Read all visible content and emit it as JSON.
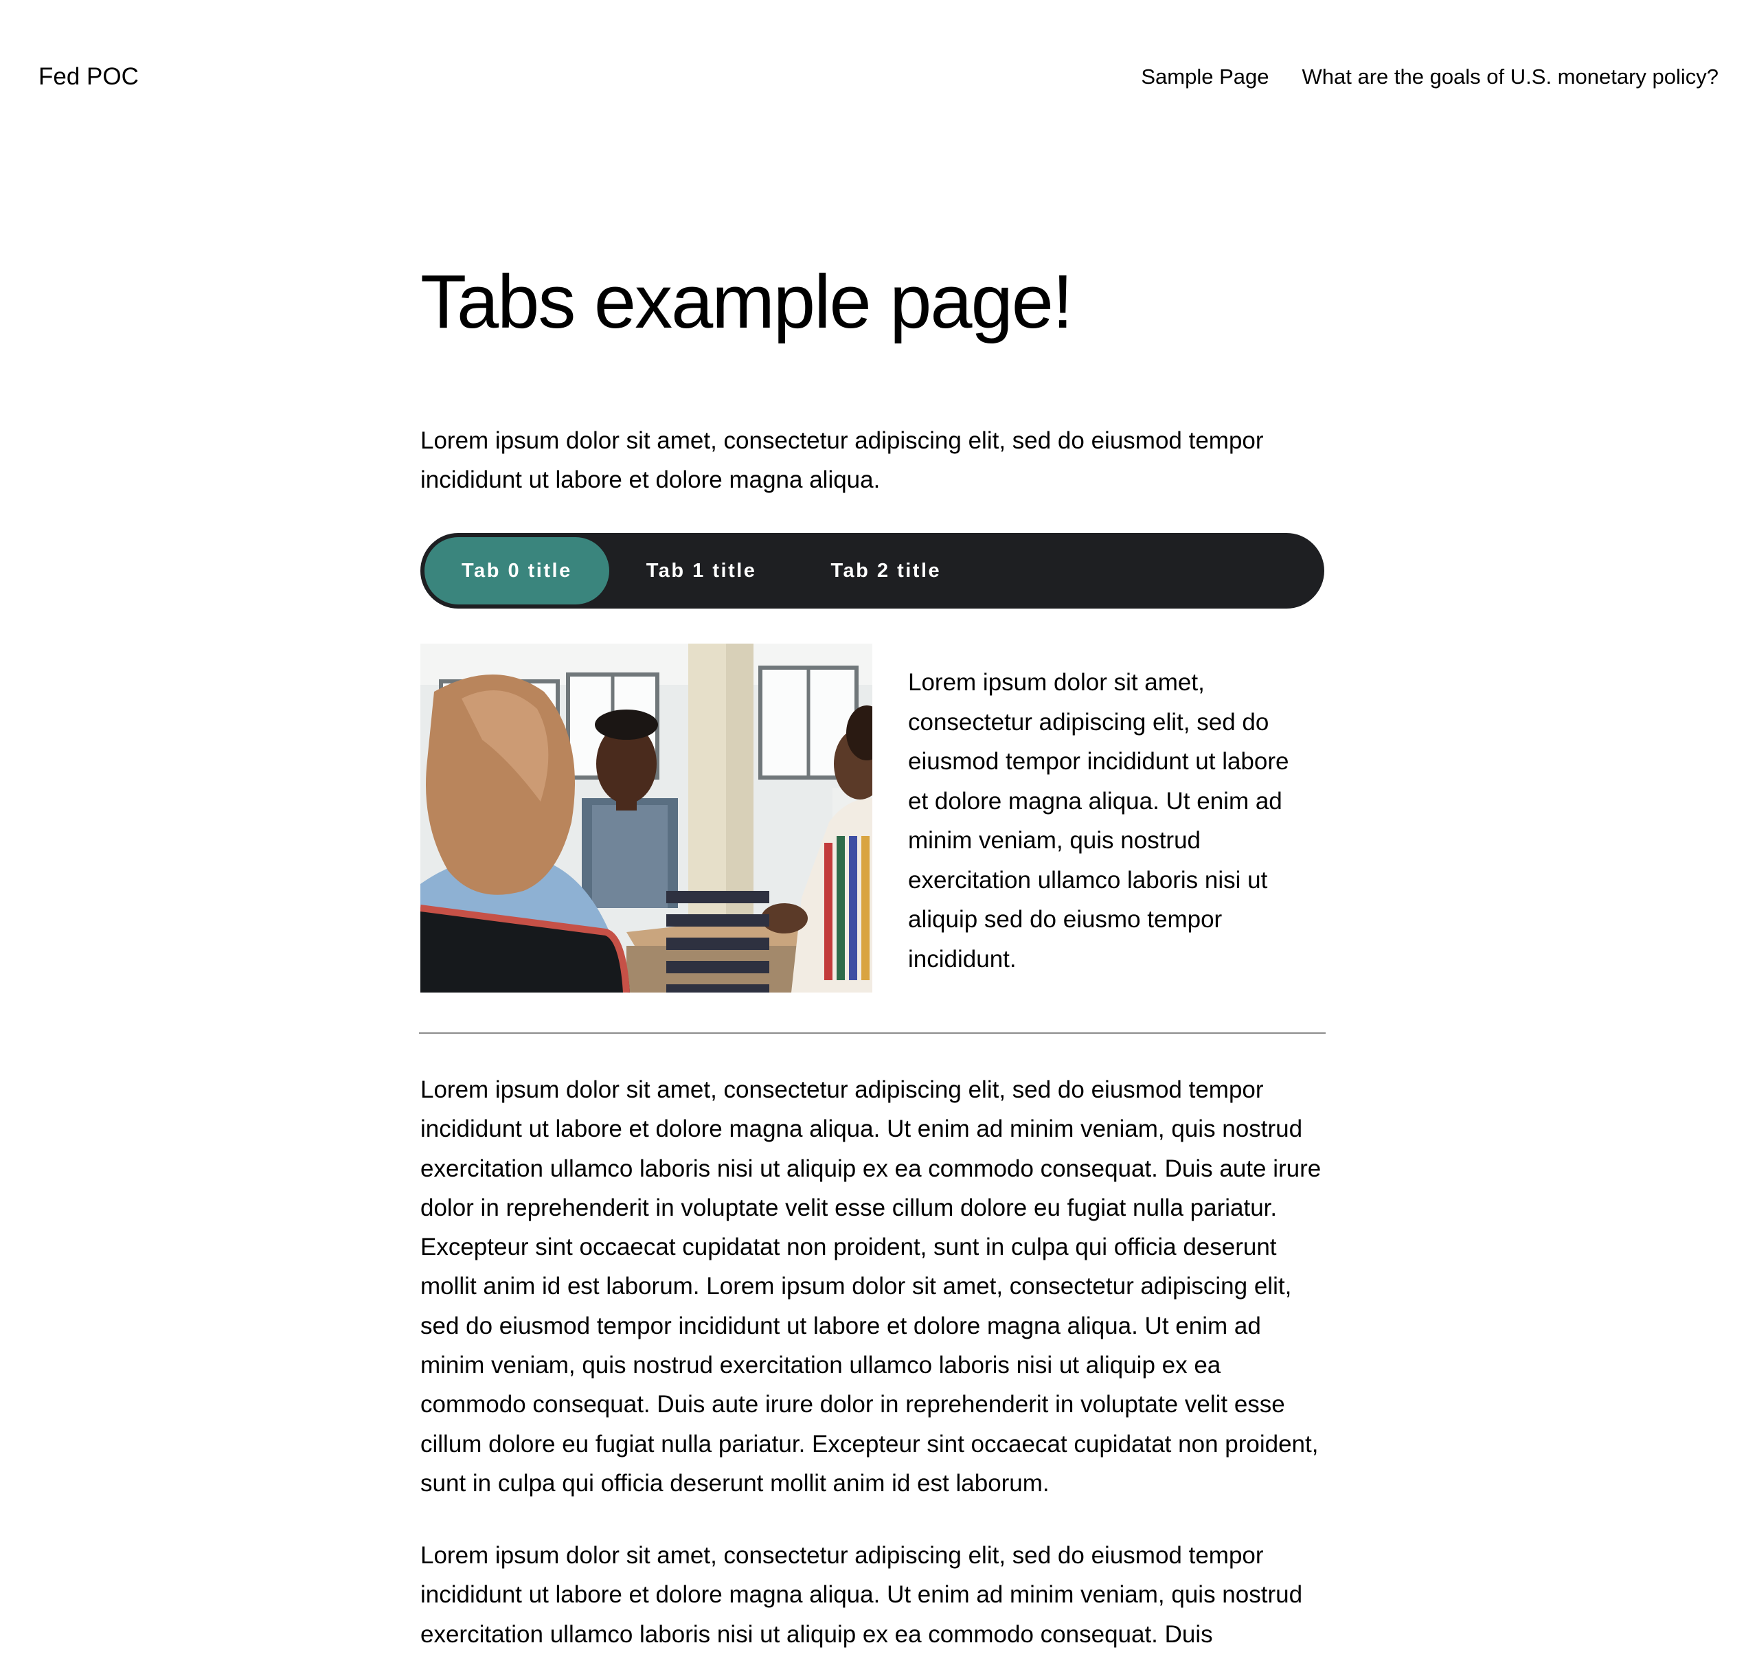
{
  "header": {
    "site_title": "Fed POC",
    "nav": [
      {
        "label": "Sample Page"
      },
      {
        "label": "What are the goals of U.S. monetary policy?"
      }
    ]
  },
  "page": {
    "title": "Tabs example page!",
    "intro": "Lorem ipsum dolor sit amet, consectetur adipiscing elit, sed do eiusmod tempor incididunt ut labore et dolore magna aliqua."
  },
  "tabs": {
    "items": [
      {
        "label": "Tab 0 title",
        "active": true
      },
      {
        "label": "Tab 1 title",
        "active": false
      },
      {
        "label": "Tab 2 title",
        "active": false
      }
    ],
    "bar_color": "#1e1f22",
    "active_color": "#3a857d"
  },
  "panel": {
    "image": "photo of people meeting around a table",
    "text": "Lorem ipsum dolor sit amet, consectetur adipiscing elit, sed do eiusmod tempor incididunt ut labore et dolore magna aliqua. Ut enim ad minim veniam, quis nostrud exercitation ullamco laboris nisi ut aliquip sed do eiusmo tempor incididunt."
  },
  "body": {
    "paragraphs": [
      "Lorem ipsum dolor sit amet, consectetur adipiscing elit, sed do eiusmod tempor incididunt ut labore et dolore magna aliqua. Ut enim ad minim veniam, quis nostrud exercitation ullamco laboris nisi ut aliquip ex ea commodo consequat. Duis aute irure dolor in reprehenderit in voluptate velit esse cillum dolore eu fugiat nulla pariatur. Excepteur sint occaecat cupidatat non proident, sunt in culpa qui officia deserunt mollit anim id est laborum. Lorem ipsum dolor sit amet, consectetur adipiscing elit, sed do eiusmod tempor incididunt ut labore et dolore magna aliqua. Ut enim ad minim veniam, quis nostrud exercitation ullamco laboris nisi ut aliquip ex ea commodo consequat. Duis aute irure dolor in reprehenderit in voluptate velit esse cillum dolore eu fugiat nulla pariatur. Excepteur sint occaecat cupidatat non proident, sunt in culpa qui officia deserunt mollit anim id est laborum.",
      "Lorem ipsum dolor sit amet, consectetur adipiscing elit, sed do eiusmod tempor incididunt ut labore et dolore magna aliqua. Ut enim ad minim veniam, quis nostrud exercitation ullamco laboris nisi ut aliquip ex ea commodo consequat. Duis"
    ]
  }
}
